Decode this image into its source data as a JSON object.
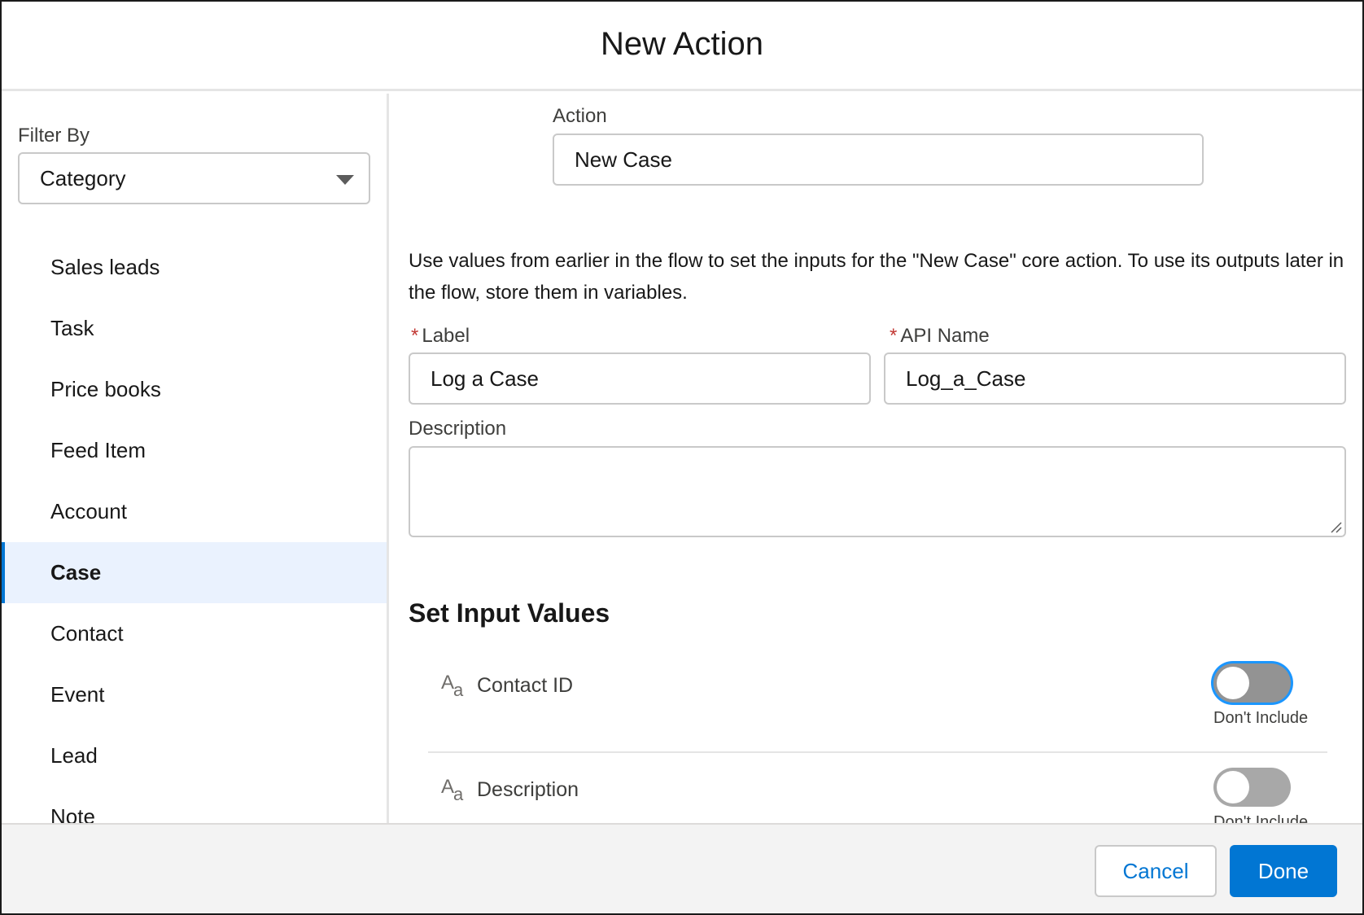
{
  "modal": {
    "title": "New Action"
  },
  "filter": {
    "label": "Filter By",
    "selected": "Category",
    "items": [
      "Sales leads",
      "Task",
      "Price books",
      "Feed Item",
      "Account",
      "Case",
      "Contact",
      "Event",
      "Lead",
      "Note"
    ],
    "active_item": "Case"
  },
  "action": {
    "label": "Action",
    "value": "New Case"
  },
  "help_text": "Use values from earlier in the flow to set the inputs for the \"New Case\" core action. To use its outputs later in the flow, store them in variables.",
  "label_field": {
    "required_mark": "*",
    "label": "Label",
    "value": "Log a Case"
  },
  "api_name_field": {
    "required_mark": "*",
    "label": "API Name",
    "value": "Log_a_Case"
  },
  "description_field": {
    "label": "Description",
    "value": ""
  },
  "input_values": {
    "heading": "Set Input Values",
    "rows": [
      {
        "icon": "text-type-icon",
        "icon_big": "A",
        "icon_small": "a",
        "label": "Contact ID",
        "toggle_text": "Don't Include",
        "checked": false
      },
      {
        "icon": "text-type-icon",
        "icon_big": "A",
        "icon_small": "a",
        "label": "Description",
        "toggle_text": "Don't Include",
        "checked": false
      }
    ]
  },
  "footer": {
    "cancel_label": "Cancel",
    "done_label": "Done"
  },
  "colors": {
    "brand": "#0176d3",
    "active_bg": "#eaf2fe",
    "required": "#c23934",
    "footer_bg": "#f3f3f3"
  }
}
